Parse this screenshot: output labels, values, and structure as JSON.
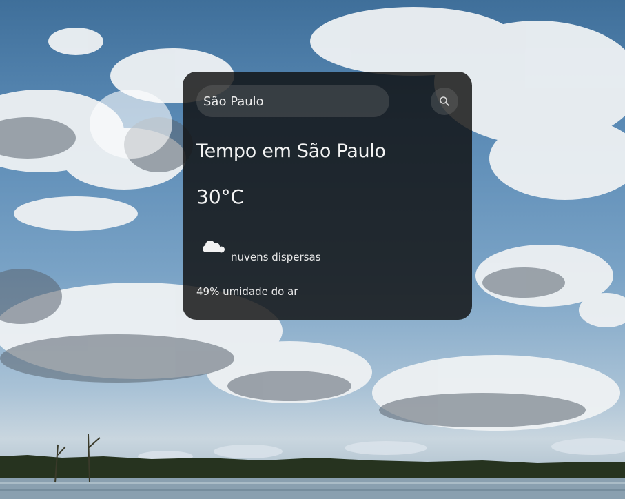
{
  "search": {
    "value": "São Paulo",
    "button_icon": "search-icon"
  },
  "weather": {
    "title": "Tempo em São Paulo",
    "temperature": "30°C",
    "description": "nuvens dispersas",
    "icon": "cloud-icon",
    "humidity": "49% umidade do ar"
  },
  "colors": {
    "card_background": "#0f0f0f",
    "text": "#f4f4f4",
    "input_background": "#7c7c7c"
  }
}
